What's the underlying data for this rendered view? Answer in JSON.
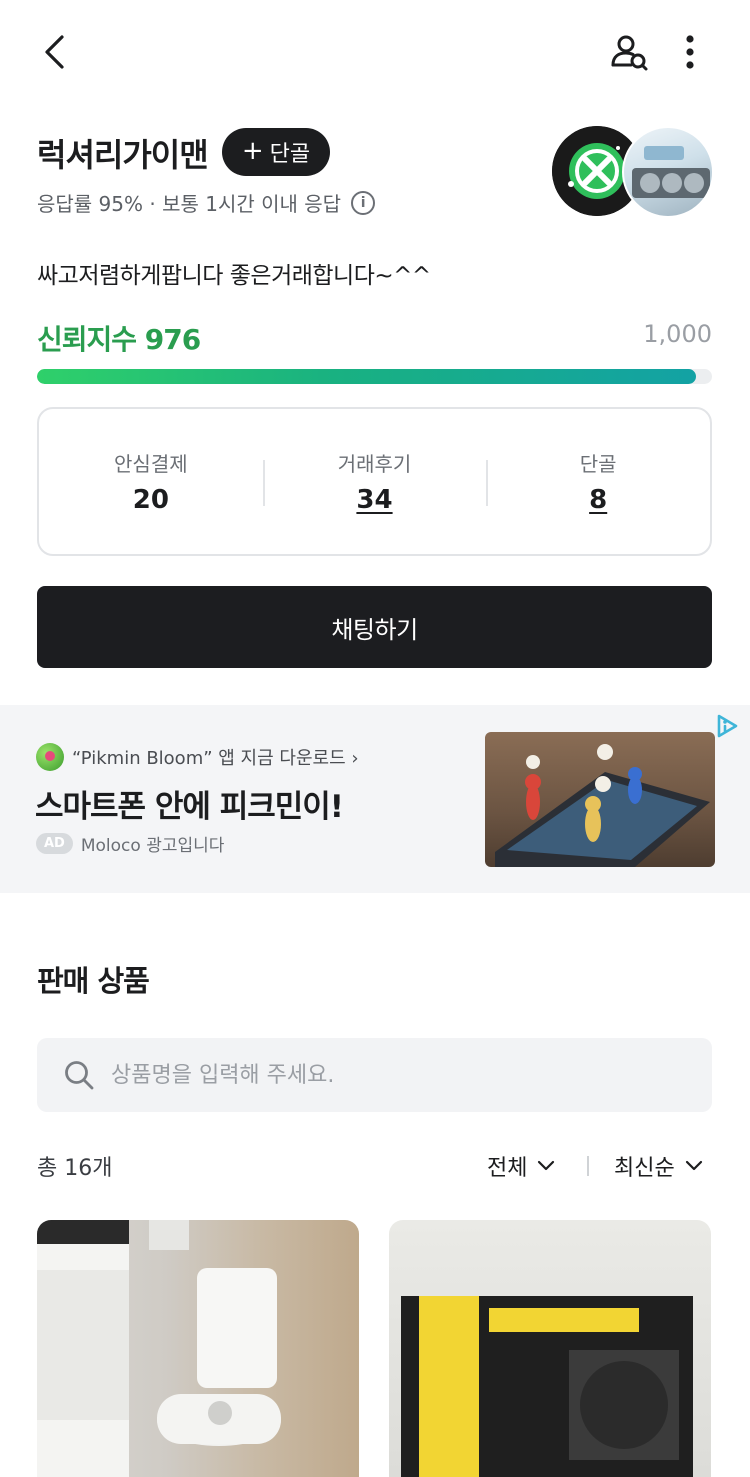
{
  "profile": {
    "name": "럭셔리가이맨",
    "follow_label": "단골",
    "response_text": "응답률 95% · 보통 1시간 이내 응답",
    "intro": "싸고저렴하게팝니다 좋은거래합니다~^^"
  },
  "trust": {
    "label": "신뢰지수 976",
    "score": 976,
    "max_label": "1,000",
    "max": 1000
  },
  "stats": [
    {
      "label": "안심결제",
      "value": "20"
    },
    {
      "label": "거래후기",
      "value": "34"
    },
    {
      "label": "단골",
      "value": "8"
    }
  ],
  "chat_button": "채팅하기",
  "ad": {
    "source": "“Pikmin Bloom” 앱 지금 다운로드 ›",
    "headline": "스마트폰 안에 피크민이!",
    "badge": "AD",
    "sponsor": "Moloco 광고입니다"
  },
  "products_section": {
    "title": "판매 상품",
    "search_placeholder": "상품명을 입력해 주세요.",
    "total": "총 16개",
    "filter_all": "전체",
    "filter_sort": "최신순"
  },
  "colors": {
    "trust_green": "#2a9d4f",
    "dark_button": "#1c1d20"
  }
}
